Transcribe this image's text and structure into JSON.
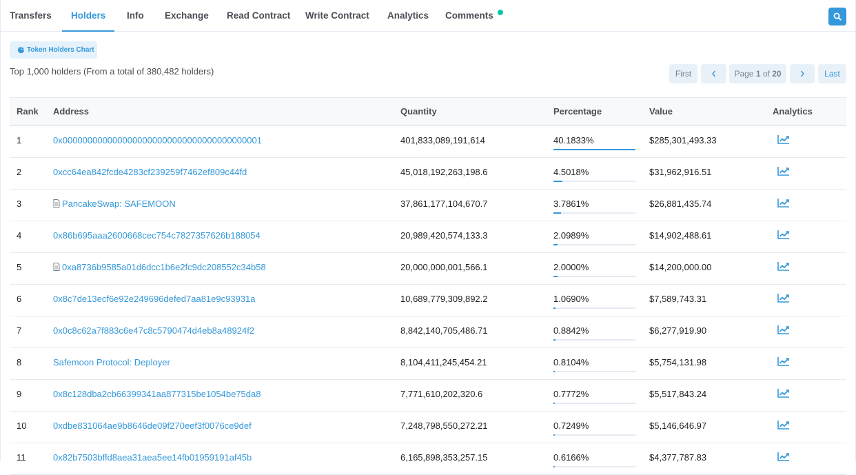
{
  "tabs": [
    {
      "label": "Transfers",
      "active": false
    },
    {
      "label": "Holders",
      "active": true
    },
    {
      "label": "Info",
      "active": false
    },
    {
      "label": "Exchange",
      "active": false
    },
    {
      "label": "Read Contract",
      "active": false
    },
    {
      "label": "Write Contract",
      "active": false
    },
    {
      "label": "Analytics",
      "active": false
    },
    {
      "label": "Comments",
      "active": false,
      "badge": "green-dot"
    }
  ],
  "search_icon": "search-icon",
  "chart_button": {
    "label": "Token Holders Chart",
    "icon": "pie-chart-icon"
  },
  "summary": "Top 1,000 holders (From a total of 380,482 holders)",
  "pagination": {
    "first": "First",
    "prev_icon": "chevron-left-icon",
    "page_prefix": "Page ",
    "page_current": "1",
    "page_mid": " of ",
    "page_total": "20",
    "next_icon": "chevron-right-icon",
    "last": "Last"
  },
  "table": {
    "headers": {
      "rank": "Rank",
      "address": "Address",
      "quantity": "Quantity",
      "percentage": "Percentage",
      "value": "Value",
      "analytics": "Analytics"
    },
    "rows": [
      {
        "rank": "1",
        "address": "0x0000000000000000000000000000000000000001",
        "contract": false,
        "quantity": "401,833,089,191,614",
        "percentage": "40.1833%",
        "pct_value": 40.1833,
        "value": "$285,301,493.33"
      },
      {
        "rank": "2",
        "address": "0xcc64ea842fcde4283cf239259f7462ef809c44fd",
        "contract": false,
        "quantity": "45,018,192,263,198.6",
        "percentage": "4.5018%",
        "pct_value": 4.5018,
        "value": "$31,962,916.51"
      },
      {
        "rank": "3",
        "address": "PancakeSwap: SAFEMOON",
        "contract": true,
        "quantity": "37,861,177,104,670.7",
        "percentage": "3.7861%",
        "pct_value": 3.7861,
        "value": "$26,881,435.74"
      },
      {
        "rank": "4",
        "address": "0x86b695aaa2600668cec754c7827357626b188054",
        "contract": false,
        "quantity": "20,989,420,574,133.3",
        "percentage": "2.0989%",
        "pct_value": 2.0989,
        "value": "$14,902,488.61"
      },
      {
        "rank": "5",
        "address": "0xa8736b9585a01d6dcc1b6e2fc9dc208552c34b58",
        "contract": true,
        "quantity": "20,000,000,001,566.1",
        "percentage": "2.0000%",
        "pct_value": 2.0,
        "value": "$14,200,000.00"
      },
      {
        "rank": "6",
        "address": "0x8c7de13ecf6e92e249696defed7aa81e9c93931a",
        "contract": false,
        "quantity": "10,689,779,309,892.2",
        "percentage": "1.0690%",
        "pct_value": 1.069,
        "value": "$7,589,743.31"
      },
      {
        "rank": "7",
        "address": "0x0c8c62a7f883c6e47c8c5790474d4eb8a48924f2",
        "contract": false,
        "quantity": "8,842,140,705,486.71",
        "percentage": "0.8842%",
        "pct_value": 0.8842,
        "value": "$6,277,919.90"
      },
      {
        "rank": "8",
        "address": "Safemoon Protocol: Deployer",
        "contract": false,
        "quantity": "8,104,411,245,454.21",
        "percentage": "0.8104%",
        "pct_value": 0.8104,
        "value": "$5,754,131.98"
      },
      {
        "rank": "9",
        "address": "0x8c128dba2cb66399341aa877315be1054be75da8",
        "contract": false,
        "quantity": "7,771,610,202,320.6",
        "percentage": "0.7772%",
        "pct_value": 0.7772,
        "value": "$5,517,843.24"
      },
      {
        "rank": "10",
        "address": "0xdbe831064ae9b8646de09f270eef3f0076ce9def",
        "contract": false,
        "quantity": "7,248,798,550,272.21",
        "percentage": "0.7249%",
        "pct_value": 0.7249,
        "value": "$5,146,646.97"
      },
      {
        "rank": "11",
        "address": "0x82b7503bffd8aea31aea5ee14fb01959191af45b",
        "contract": false,
        "quantity": "6,165,898,353,257.15",
        "percentage": "0.6166%",
        "pct_value": 0.6166,
        "value": "$4,377,787.83"
      }
    ],
    "row_icon": "trend-chart-icon"
  },
  "colors": {
    "accent": "#3498db",
    "badge": "#00c9a7",
    "border": "#e7eaf3"
  }
}
